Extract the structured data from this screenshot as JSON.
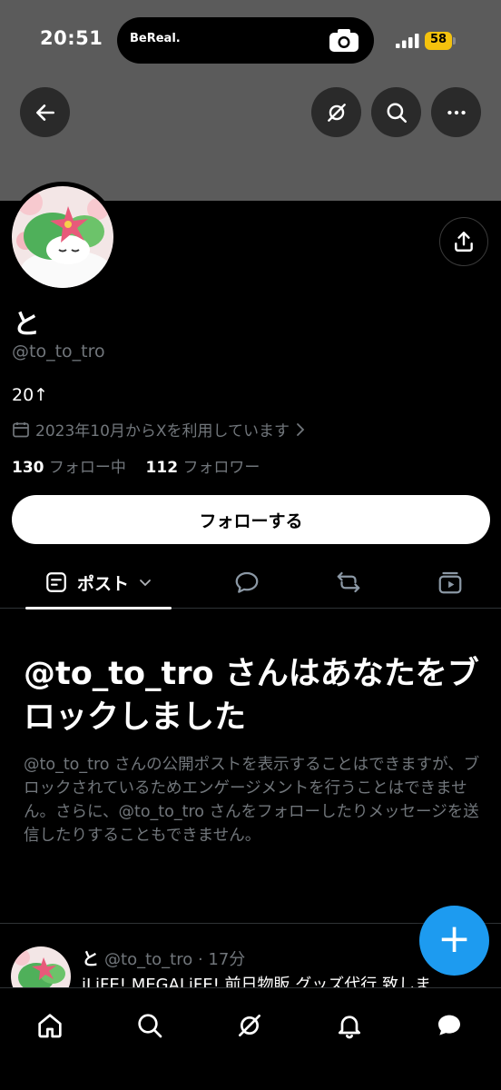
{
  "status_bar": {
    "time": "20:51",
    "island_app": "BeReal.",
    "battery": "58",
    "battery_color": "#f4c20d"
  },
  "header": {
    "back_icon": "arrow-left-icon",
    "grok_icon": "grok-icon",
    "search_icon": "search-icon",
    "more_icon": "more-icon",
    "share_icon": "share-icon"
  },
  "profile": {
    "display_name": "と",
    "handle": "@to_to_tro",
    "bio": "20↑",
    "joined": "2023年10月からXを利用しています",
    "following_count": "130",
    "following_label": "フォロー中",
    "followers_count": "112",
    "followers_label": "フォロワー",
    "follow_button": "フォローする"
  },
  "tabs": {
    "posts_label": "ポスト"
  },
  "block_notice": {
    "title": "@to_to_tro さんはあなたをブロックしました",
    "description": "@to_to_tro さんの公開ポストを表示することはできますが、ブロックされているためエンゲージメントを行うことはできません。さらに、@to_to_tro さんをフォローしたりメッセージを送信したりすることもできません。"
  },
  "post": {
    "name": "と",
    "handle_time": "@to_to_tro · 17分",
    "text": "iLiFE! MEGALiFE! 前日物販 グッズ代行 致しま"
  },
  "fab_label": "+",
  "bottom_nav": [
    "home-icon",
    "search-icon",
    "grok-icon",
    "notifications-icon",
    "messages-icon"
  ],
  "colors": {
    "accent": "#1d9bf0",
    "background": "#000000",
    "banner": "#5b5b5b",
    "muted_text": "#71767b"
  }
}
